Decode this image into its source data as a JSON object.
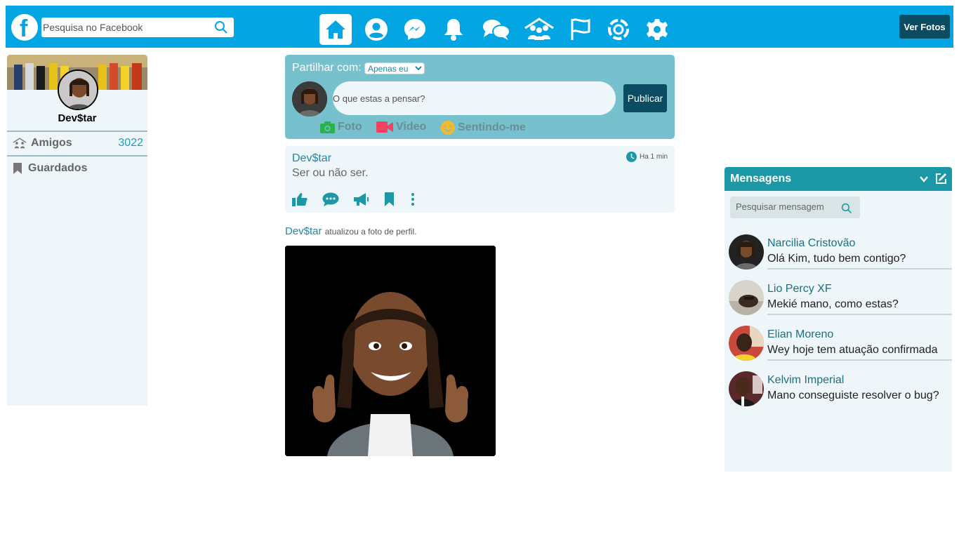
{
  "topbar": {
    "logo_letter": "f",
    "search_placeholder": "Pesquisa no Facebook",
    "nav_icons": [
      "home-icon",
      "profile-icon",
      "messenger-icon",
      "bell-icon",
      "chat-icon",
      "friends-icon",
      "flag-icon",
      "memories-icon",
      "gear-icon"
    ],
    "ver_fotos_label": "Ver Fotos",
    "accent": "#03a5e3"
  },
  "sidebar": {
    "profile_name": "Dev$tar",
    "items": [
      {
        "label": "Amigos",
        "count": "3022",
        "icon": "friends-icon"
      },
      {
        "label": "Guardados",
        "icon": "bookmark-icon"
      }
    ]
  },
  "composer": {
    "share_label": "Partilhar com:",
    "share_option": "Apenas eu",
    "input_placeholder": "O que estas a pensar?",
    "publish_label": "Publicar",
    "actions": [
      {
        "label": "Foto",
        "icon": "camera-icon",
        "color": "#2bb24c"
      },
      {
        "label": "Video",
        "icon": "video-icon",
        "color": "#f3425f"
      },
      {
        "label": "Sentindo-me",
        "icon": "smiley-icon",
        "color": "#f7b928"
      }
    ]
  },
  "post": {
    "author": "Dev$tar",
    "time": "Ha 1 min",
    "text": "Ser ou não ser.",
    "actions": [
      "like-icon",
      "comment-icon",
      "share-icon",
      "bookmark-icon",
      "more-icon"
    ]
  },
  "activity": {
    "author": "Dev$tar",
    "text": "atualizou a foto de perfil."
  },
  "messages": {
    "title": "Mensagens",
    "search_placeholder": "Pesquisar mensagem",
    "items": [
      {
        "name": "Narcilia Cristovão",
        "text": "Olá Kim, tudo bem contigo?"
      },
      {
        "name": "Lio Percy XF",
        "text": "Mekié mano, como estas?"
      },
      {
        "name": "Elian Moreno",
        "text": "Wey hoje tem atuação confirmada"
      },
      {
        "name": "Kelvim Imperial",
        "text": "Mano conseguiste resolver o bug?"
      }
    ]
  }
}
